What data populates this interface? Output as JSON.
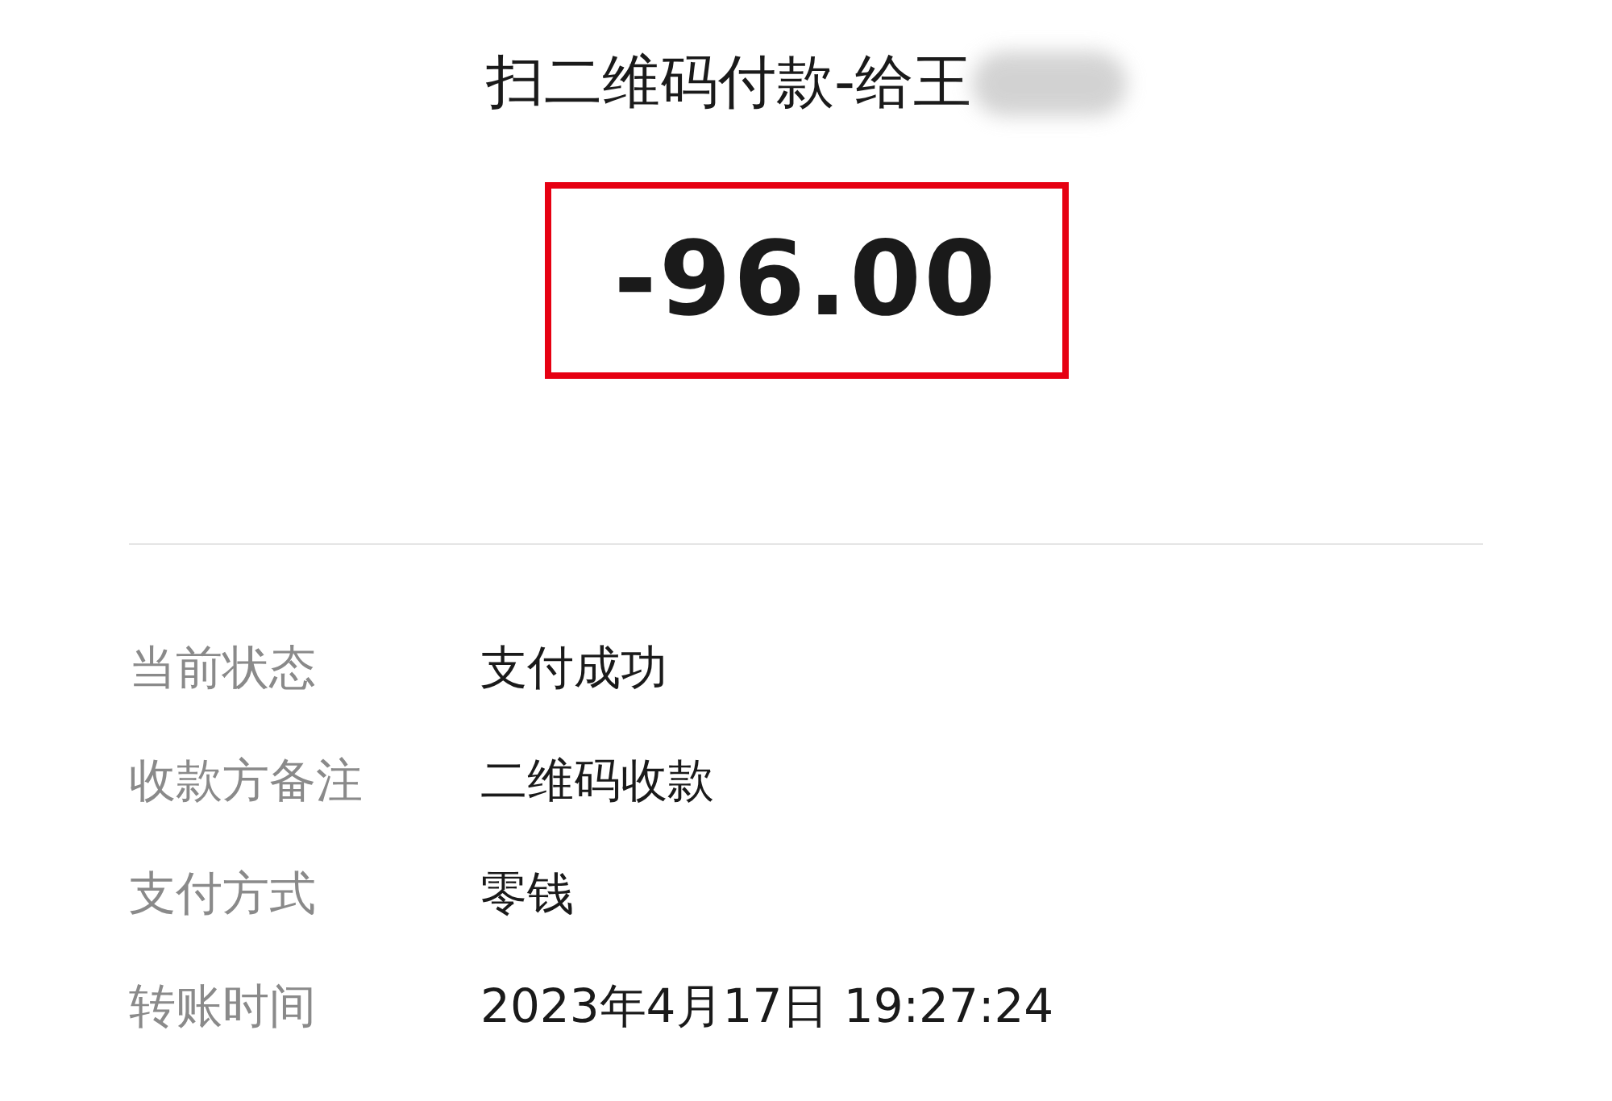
{
  "title": "扫二维码付款-给王",
  "amount": {
    "text": "-96.00",
    "highlighted": true
  },
  "details": [
    {
      "label": "当前状态",
      "value": "支付成功"
    },
    {
      "label": "收款方备注",
      "value": "二维码收款"
    },
    {
      "label": "支付方式",
      "value": "零钱"
    },
    {
      "label": "转账时间",
      "value": "2023年4月17日 19:27:24"
    }
  ]
}
